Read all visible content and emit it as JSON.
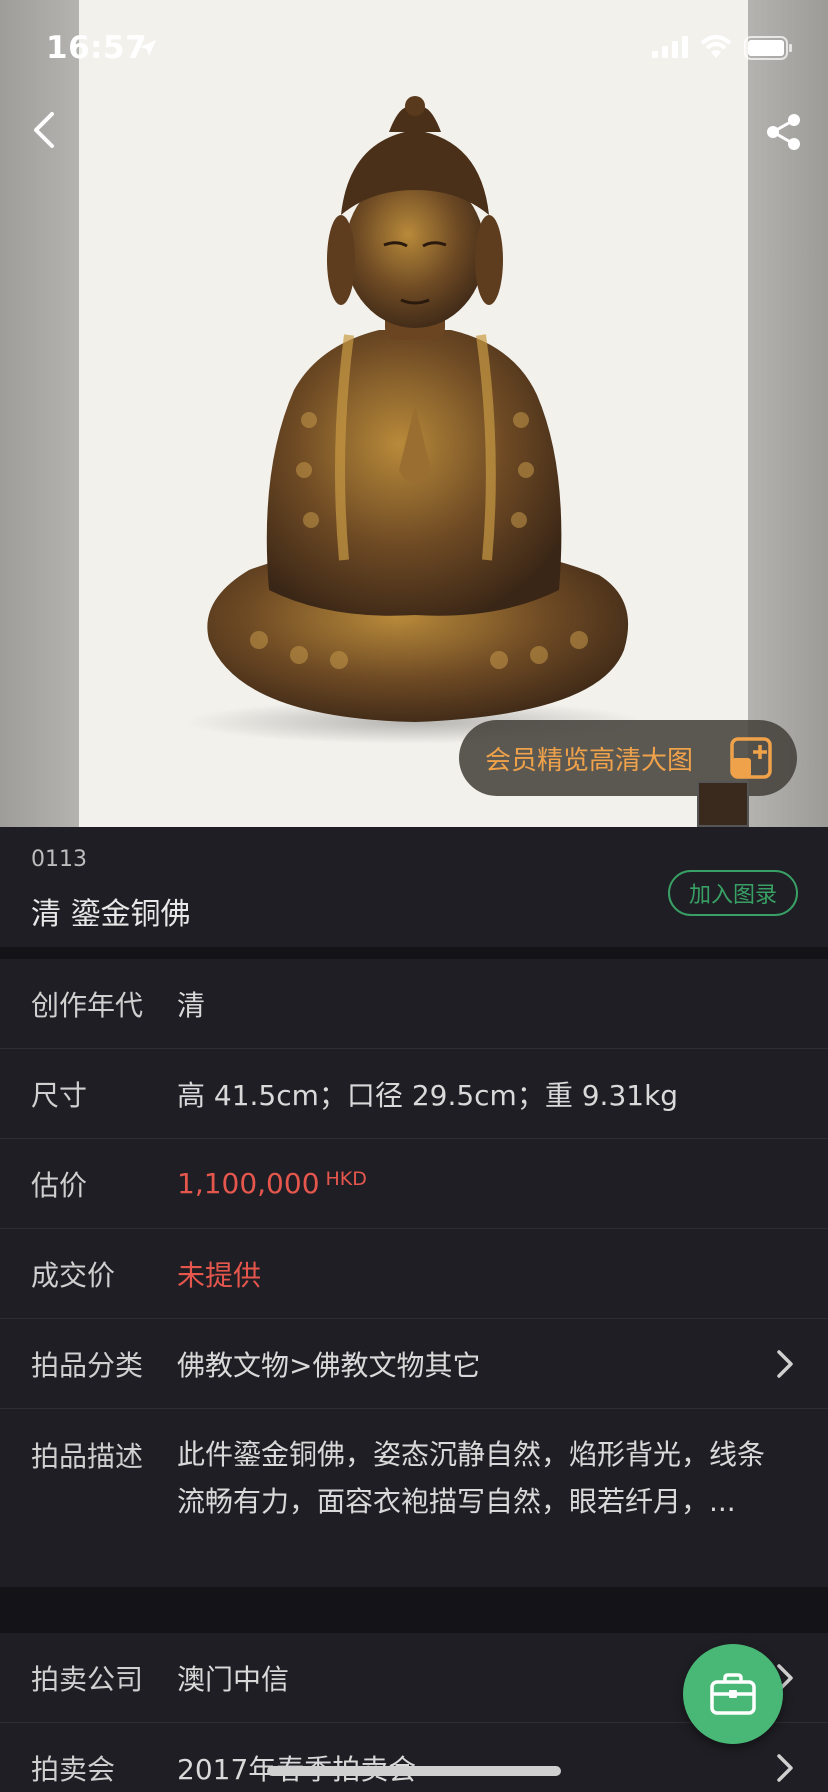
{
  "status": {
    "time": "16:57"
  },
  "hero": {
    "hd_button": "会员精览高清大图"
  },
  "lot": {
    "number": "0113",
    "name": "清 鎏金铜佛",
    "catalog_button": "加入图录"
  },
  "details": [
    {
      "label": "创作年代",
      "value": "清"
    },
    {
      "label": "尺寸",
      "value": "高 41.5cm；口径 29.5cm；重 9.31kg"
    },
    {
      "label": "估价",
      "value": "1,100,000",
      "currency": "HKD"
    },
    {
      "label": "成交价",
      "value": "未提供"
    },
    {
      "label": "拍品分类",
      "value": "佛教文物>佛教文物其它"
    },
    {
      "label": "拍品描述",
      "value": "此件鎏金铜佛，姿态沉静自然，焰形背光，线条流畅有力，面容衣袍描写自然，眼若纤月，..."
    }
  ],
  "auction": [
    {
      "label": "拍卖公司",
      "value": "澳门中信"
    },
    {
      "label": "拍卖会",
      "value": "2017年春季拍卖会"
    }
  ],
  "colors": {
    "accent_orange": "#f0a24a",
    "accent_green": "#39a065",
    "price_red": "#e5564d",
    "fab_green": "#49b877"
  },
  "icons": [
    "back-icon",
    "share-icon",
    "location-arrow-icon",
    "signal-icon",
    "wifi-icon",
    "battery-icon",
    "hd-zoom-icon",
    "chevron-right-icon",
    "briefcase-icon"
  ]
}
